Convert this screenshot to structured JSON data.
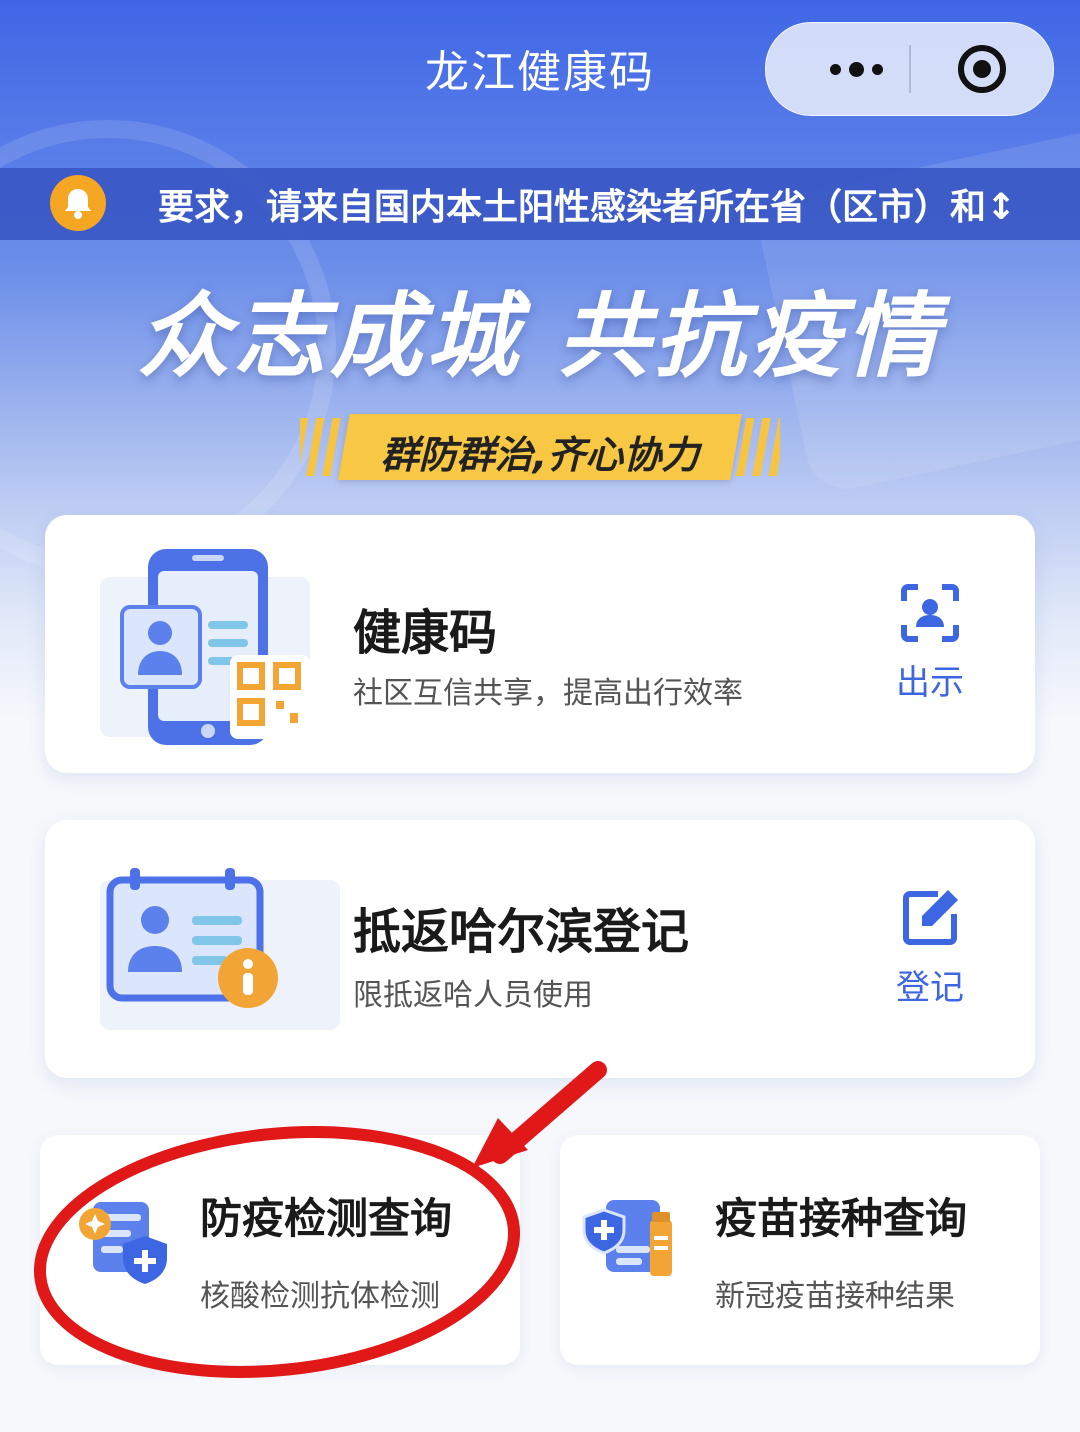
{
  "header": {
    "title": "龙江健康码",
    "more_icon": "more-dots-icon",
    "close_icon": "target-circle-icon"
  },
  "notice": {
    "icon": "bell-icon",
    "text": "要求，请来自国内本土阳性感染者所在省（区市）和↕"
  },
  "hero": {
    "slogan": "众志成城 共抗疫情",
    "banner": "群防群治,齐心协力"
  },
  "cards": [
    {
      "title": "健康码",
      "subtitle": "社区互信共享，提高出行效率",
      "action_label": "出示",
      "action_icon": "face-scan-icon",
      "illustration": "phone-qr-illustration"
    },
    {
      "title": "抵返哈尔滨登记",
      "subtitle": "限抵返哈人员使用",
      "action_label": "登记",
      "action_icon": "edit-form-icon",
      "illustration": "id-card-info-illustration"
    }
  ],
  "services": [
    {
      "title": "防疫检测查询",
      "subtitle": "核酸检测抗体检测",
      "icon": "test-report-shield-icon"
    },
    {
      "title": "疫苗接种查询",
      "subtitle": "新冠疫苗接种结果",
      "icon": "vaccine-shield-icon"
    }
  ],
  "colors": {
    "accent": "#3d66e3",
    "notice_bar": "#3a58c4",
    "banner": "#f8c845",
    "annotation_red": "#e01818"
  }
}
